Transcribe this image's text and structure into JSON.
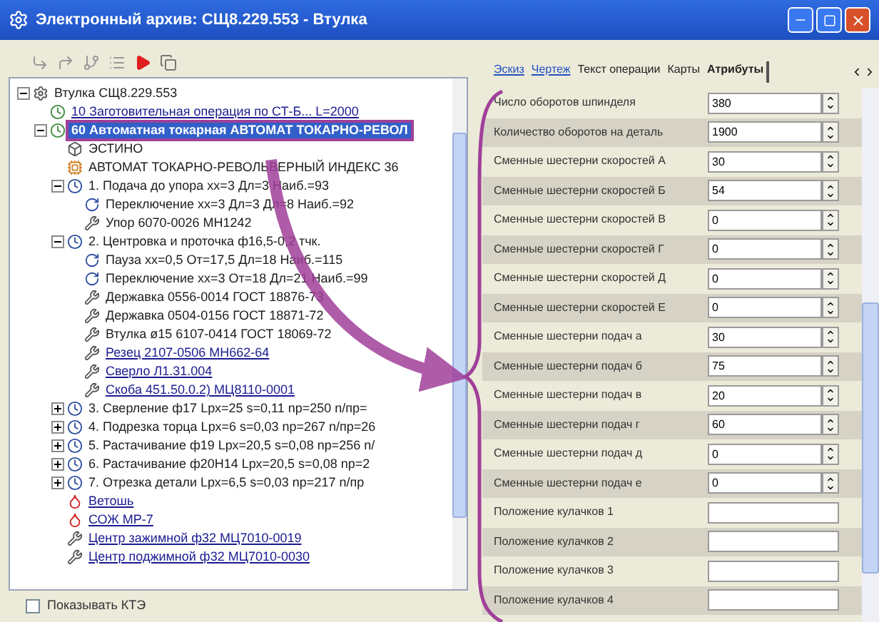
{
  "window": {
    "title": "Электронный архив: СЩ8.229.553 - Втулка"
  },
  "tree": [
    {
      "label": "Втулка СЩ8.229.553",
      "kind": "root",
      "expanded": true,
      "selected": false,
      "color": "#1c1c1c",
      "children": [
        {
          "label": "10 Заготовительная операция по СТ-Б... L=2000",
          "kind": "operation",
          "selected": false,
          "color": "#1a1a90"
        },
        {
          "label": "60 Автоматная токарная АВТОМАТ ТОКАРНО-РЕВОЛ",
          "kind": "operation",
          "expanded": true,
          "selected": true,
          "children": [
            {
              "label": "ЭСТИНО",
              "kind": "equipment",
              "selected": false,
              "color": "#1c1c1c"
            },
            {
              "label": "АВТОМАТ ТОКАРНО-РЕВОЛЬВЕРНЫЙ ИНДЕКС 36",
              "kind": "machine",
              "selected": false,
              "color": "#1c1c1c"
            },
            {
              "label": "1. Подача до упора хх=3 Дл=3 Наиб.=93",
              "kind": "step",
              "expanded": true,
              "selected": false,
              "color": "#1c1c1c",
              "children": [
                {
                  "label": "Переключение хх=3 Дл=3 Дл=8 Наиб.=92",
                  "kind": "transition",
                  "selected": false,
                  "color": "#1c1c1c"
                },
                {
                  "label": "Упор 6070-0026 МН1242",
                  "kind": "tool",
                  "selected": false,
                  "color": "#1c1c1c"
                }
              ]
            },
            {
              "label": "2. Центровка и проточка ф16,5-0,2 тчк.",
              "kind": "step",
              "expanded": true,
              "selected": false,
              "color": "#1c1c1c",
              "children": [
                {
                  "label": "Пауза хх=0,5 От=17,5 Дл=18 Наиб.=115",
                  "kind": "transition",
                  "selected": false,
                  "color": "#1c1c1c"
                },
                {
                  "label": "Переключение хх=3 От=18 Дл=21 Наиб.=99",
                  "kind": "transition",
                  "selected": false,
                  "color": "#1c1c1c"
                },
                {
                  "label": "Державка 0556-0014 ГОСТ 18876-73",
                  "kind": "tool",
                  "selected": false,
                  "color": "#1c1c1c"
                },
                {
                  "label": "Державка 0504-0156 ГОСТ 18871-72",
                  "kind": "tool",
                  "selected": false,
                  "color": "#1c1c1c"
                },
                {
                  "label": "Втулка ø15 6107-0414 ГОСТ 18069-72",
                  "kind": "tool",
                  "selected": false,
                  "color": "#1c1c1c"
                },
                {
                  "label": "Резец 2107-0506  МН662-64",
                  "kind": "tool",
                  "selected": false,
                  "color": "#1a1a90"
                },
                {
                  "label": "Сверло Л1.31.004",
                  "kind": "tool",
                  "selected": false,
                  "color": "#1a1a90"
                },
                {
                  "label": "Скоба 451.50.0.2)  МЦ8110-0001",
                  "kind": "tool",
                  "selected": false,
                  "color": "#1a1a90"
                }
              ]
            },
            {
              "label": "3. Сверление ф17   Lрх=25 s=0,11 nр=250 n/пр=",
              "kind": "step",
              "expanded": false,
              "selected": false,
              "color": "#1c1c1c"
            },
            {
              "label": "4. Подрезка торца  Lрх=6 s=0,03 nр=267 n/пр=26",
              "kind": "step",
              "expanded": false,
              "selected": false,
              "color": "#1c1c1c"
            },
            {
              "label": "5. Растачивание ф19  Lрх=20,5 s=0,08 nр=256 n/",
              "kind": "step",
              "expanded": false,
              "selected": false,
              "color": "#1c1c1c"
            },
            {
              "label": "6. Растачивание ф20Н14  Lрх=20,5 s=0,08 nр=2",
              "kind": "step",
              "expanded": false,
              "selected": false,
              "color": "#1c1c1c"
            },
            {
              "label": "7. Отрезка детали  Lрх=6,5 s=0,03 nр=217 n/пр",
              "kind": "step",
              "expanded": false,
              "selected": false,
              "color": "#1c1c1c"
            },
            {
              "label": "Ветошь",
              "kind": "material",
              "selected": false,
              "color": "#1a1a90"
            },
            {
              "label": "СОЖ МР-7",
              "kind": "material",
              "selected": false,
              "color": "#1a1a90"
            },
            {
              "label": "Центр зажимной  ф32 МЦ7010-0019",
              "kind": "tool",
              "selected": false,
              "color": "#1a1a90"
            },
            {
              "label": "Центр поджимной  ф32 МЦ7010-0030",
              "kind": "tool",
              "selected": false,
              "color": "#1a1a90"
            }
          ]
        }
      ]
    }
  ],
  "show_kte": {
    "label": "Показывать КТЭ",
    "checked": false
  },
  "tabs": [
    {
      "label": "Эскиз",
      "kind": "link",
      "selected": false
    },
    {
      "label": "Чертеж",
      "kind": "link",
      "selected": false
    },
    {
      "label": "Текст операции",
      "kind": "tab",
      "selected": false
    },
    {
      "label": "Карты",
      "kind": "tab",
      "selected": false
    },
    {
      "label": "Атрибуты",
      "kind": "tab",
      "selected": true
    }
  ],
  "fields": [
    {
      "label": "Число оборотов шпинделя",
      "value": "380",
      "kind": "spin"
    },
    {
      "label": "Количество оборотов на деталь",
      "value": "1900",
      "kind": "spin"
    },
    {
      "label": "Сменные шестерни скоростей А",
      "value": "30",
      "kind": "spin"
    },
    {
      "label": "Сменные шестерни скоростей Б",
      "value": "54",
      "kind": "spin"
    },
    {
      "label": "Сменные шестерни скоростей В",
      "value": "0",
      "kind": "spin"
    },
    {
      "label": "Сменные шестерни скоростей Г",
      "value": "0",
      "kind": "spin"
    },
    {
      "label": "Сменные шестерни скоростей Д",
      "value": "0",
      "kind": "spin"
    },
    {
      "label": "Сменные шестерни скоростей Е",
      "value": "0",
      "kind": "spin"
    },
    {
      "label": "Сменные шестерни подач а",
      "value": "30",
      "kind": "spin"
    },
    {
      "label": "Сменные шестерни подач б",
      "value": "75",
      "kind": "spin"
    },
    {
      "label": "Сменные шестерни подач в",
      "value": "20",
      "kind": "spin"
    },
    {
      "label": "Сменные шестерни подач г",
      "value": "60",
      "kind": "spin"
    },
    {
      "label": "Сменные шестерни подач д",
      "value": "0",
      "kind": "spin"
    },
    {
      "label": "Сменные шестерни подач е",
      "value": "0",
      "kind": "spin"
    },
    {
      "label": "Положение кулачков 1",
      "kind": "text"
    },
    {
      "label": "Положение кулачков 2",
      "kind": "text"
    },
    {
      "label": "Положение кулачков 3",
      "kind": "text"
    },
    {
      "label": "Положение кулачков 4",
      "kind": "text"
    }
  ]
}
